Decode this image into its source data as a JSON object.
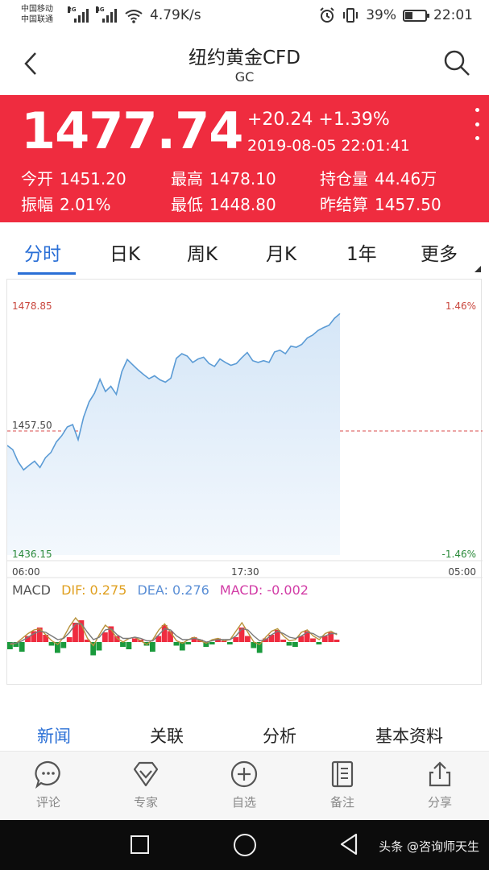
{
  "status_bar": {
    "carrier_1": "中国移动",
    "carrier_2": "中国联通",
    "net_1": "2G",
    "net_2": "4G",
    "speed": "4.79K/s",
    "battery": "39%",
    "battery_level": 0.39,
    "time": "22:01"
  },
  "header": {
    "title": "纽约黄金CFD",
    "subtitle": "GC",
    "back_icon": "chevron-left-icon",
    "search_icon": "search-icon"
  },
  "quote": {
    "price": "1477.74",
    "change": "+20.24 +1.39%",
    "datetime": "2019-08-05 22:01:41",
    "stats": [
      {
        "label": "今开",
        "value": "1451.20"
      },
      {
        "label": "最高",
        "value": "1478.10"
      },
      {
        "label": "持仓量",
        "value": "44.46万"
      },
      {
        "label": "振幅",
        "value": "2.01%"
      },
      {
        "label": "最低",
        "value": "1448.80"
      },
      {
        "label": "昨结算",
        "value": "1457.50"
      }
    ]
  },
  "tabs": [
    "分时",
    "日K",
    "周K",
    "月K",
    "1年",
    "更多"
  ],
  "active_tab": "分时",
  "chart_axis": {
    "y_top": "1478.85",
    "y_mid": "1457.50",
    "y_bottom": "1436.15",
    "pct_top": "1.46%",
    "pct_bottom": "-1.46%",
    "x_start": "06:00",
    "x_mid": "17:30",
    "x_end": "05:00"
  },
  "macd_legend": {
    "name": "MACD",
    "dif": "DIF: 0.275",
    "dea": "DEA: 0.276",
    "macd": "MACD: -0.002"
  },
  "chart_data": {
    "type": "line",
    "y_range": [
      1436.15,
      1478.85
    ],
    "reference_line": 1457.5,
    "x_range": [
      "06:00",
      "05:00"
    ],
    "elapsed_fraction_plotted": 0.7,
    "series": [
      {
        "values": [
          1455.0,
          1454.3,
          1452.2,
          1450.8,
          1451.6,
          1452.3,
          1451.2,
          1452.9,
          1453.8,
          1455.6,
          1456.7,
          1458.2,
          1458.6,
          1456.0,
          1459.9,
          1462.5,
          1464.0,
          1466.4,
          1464.3,
          1465.2,
          1463.8,
          1467.7,
          1469.8,
          1468.9,
          1468.0,
          1467.2,
          1466.5,
          1467.0,
          1466.3,
          1465.9,
          1466.6,
          1470.0,
          1470.8,
          1470.4,
          1469.3,
          1469.9,
          1470.2,
          1469.1,
          1468.6,
          1469.9,
          1469.3,
          1468.8,
          1469.1,
          1470.1,
          1471.0,
          1469.6,
          1469.3,
          1469.6,
          1469.3,
          1471.1,
          1471.4,
          1470.8,
          1472.1,
          1471.9,
          1472.4,
          1473.5,
          1474.0,
          1474.8,
          1475.3,
          1475.7,
          1476.9,
          1477.7
        ]
      }
    ],
    "macd_histogram": [
      -0.6,
      -0.4,
      -0.8,
      0.5,
      0.9,
      1.2,
      0.6,
      -0.3,
      -0.9,
      -0.5,
      0.4,
      1.6,
      1.8,
      0.2,
      -1.1,
      -0.7,
      0.8,
      1.3,
      0.5,
      -0.4,
      -0.6,
      0.3,
      0.2,
      -0.3,
      -0.8,
      0.5,
      1.4,
      0.9,
      -0.3,
      -0.7,
      -0.2,
      0.4,
      0.2,
      -0.4,
      -0.2,
      0.3,
      0.1,
      -0.2,
      0.4,
      1.2,
      0.5,
      -0.5,
      -0.9,
      0.3,
      0.6,
      1.0,
      0.2,
      -0.3,
      -0.4,
      0.5,
      0.9,
      0.3,
      -0.2,
      0.5,
      0.8,
      0.2
    ],
    "macd_dif": [
      -0.2,
      -0.1,
      0.3,
      0.7,
      1.0,
      1.1,
      0.6,
      0.1,
      -0.2,
      0.4,
      1.3,
      2.0,
      1.4,
      0.3,
      -0.3,
      0.6,
      1.4,
      1.0,
      0.3,
      0.0,
      0.3,
      0.4,
      0.1,
      -0.2,
      0.2,
      1.0,
      1.5,
      0.8,
      0.1,
      -0.1,
      0.2,
      0.4,
      0.1,
      -0.1,
      0.2,
      0.3,
      0.1,
      0.2,
      0.9,
      1.6,
      0.8,
      0.0,
      -0.2,
      0.4,
      0.9,
      1.1,
      0.5,
      0.1,
      0.2,
      0.8,
      1.0,
      0.5,
      0.2,
      0.7,
      0.9,
      0.6
    ],
    "macd_dea": [
      -0.1,
      -0.1,
      0.1,
      0.4,
      0.7,
      0.9,
      0.8,
      0.5,
      0.2,
      0.3,
      0.8,
      1.5,
      1.5,
      0.8,
      0.2,
      0.4,
      1.0,
      1.1,
      0.6,
      0.3,
      0.3,
      0.4,
      0.3,
      0.1,
      0.1,
      0.6,
      1.1,
      1.0,
      0.5,
      0.2,
      0.2,
      0.3,
      0.2,
      0.0,
      0.1,
      0.2,
      0.2,
      0.2,
      0.5,
      1.1,
      1.0,
      0.5,
      0.1,
      0.2,
      0.6,
      0.9,
      0.7,
      0.4,
      0.3,
      0.5,
      0.8,
      0.7,
      0.4,
      0.5,
      0.7,
      0.7
    ]
  },
  "colors": {
    "up": "#ef2c3f",
    "down": "#1a9a3c",
    "line": "#5b9bd5",
    "dif": "#e0a020",
    "dea": "#5b8fd6",
    "macd": "#d23ca6",
    "active": "#2a6fd6"
  },
  "section_tabs": [
    "新闻",
    "关联",
    "分析",
    "基本资料"
  ],
  "active_section_tab": "新闻",
  "toolbar": [
    {
      "label": "评论",
      "icon": "comment-icon"
    },
    {
      "label": "专家",
      "icon": "diamond-icon"
    },
    {
      "label": "自选",
      "icon": "add-circle-icon"
    },
    {
      "label": "备注",
      "icon": "note-icon"
    },
    {
      "label": "分享",
      "icon": "share-icon"
    }
  ],
  "watermark": "头条 @咨询师天生"
}
